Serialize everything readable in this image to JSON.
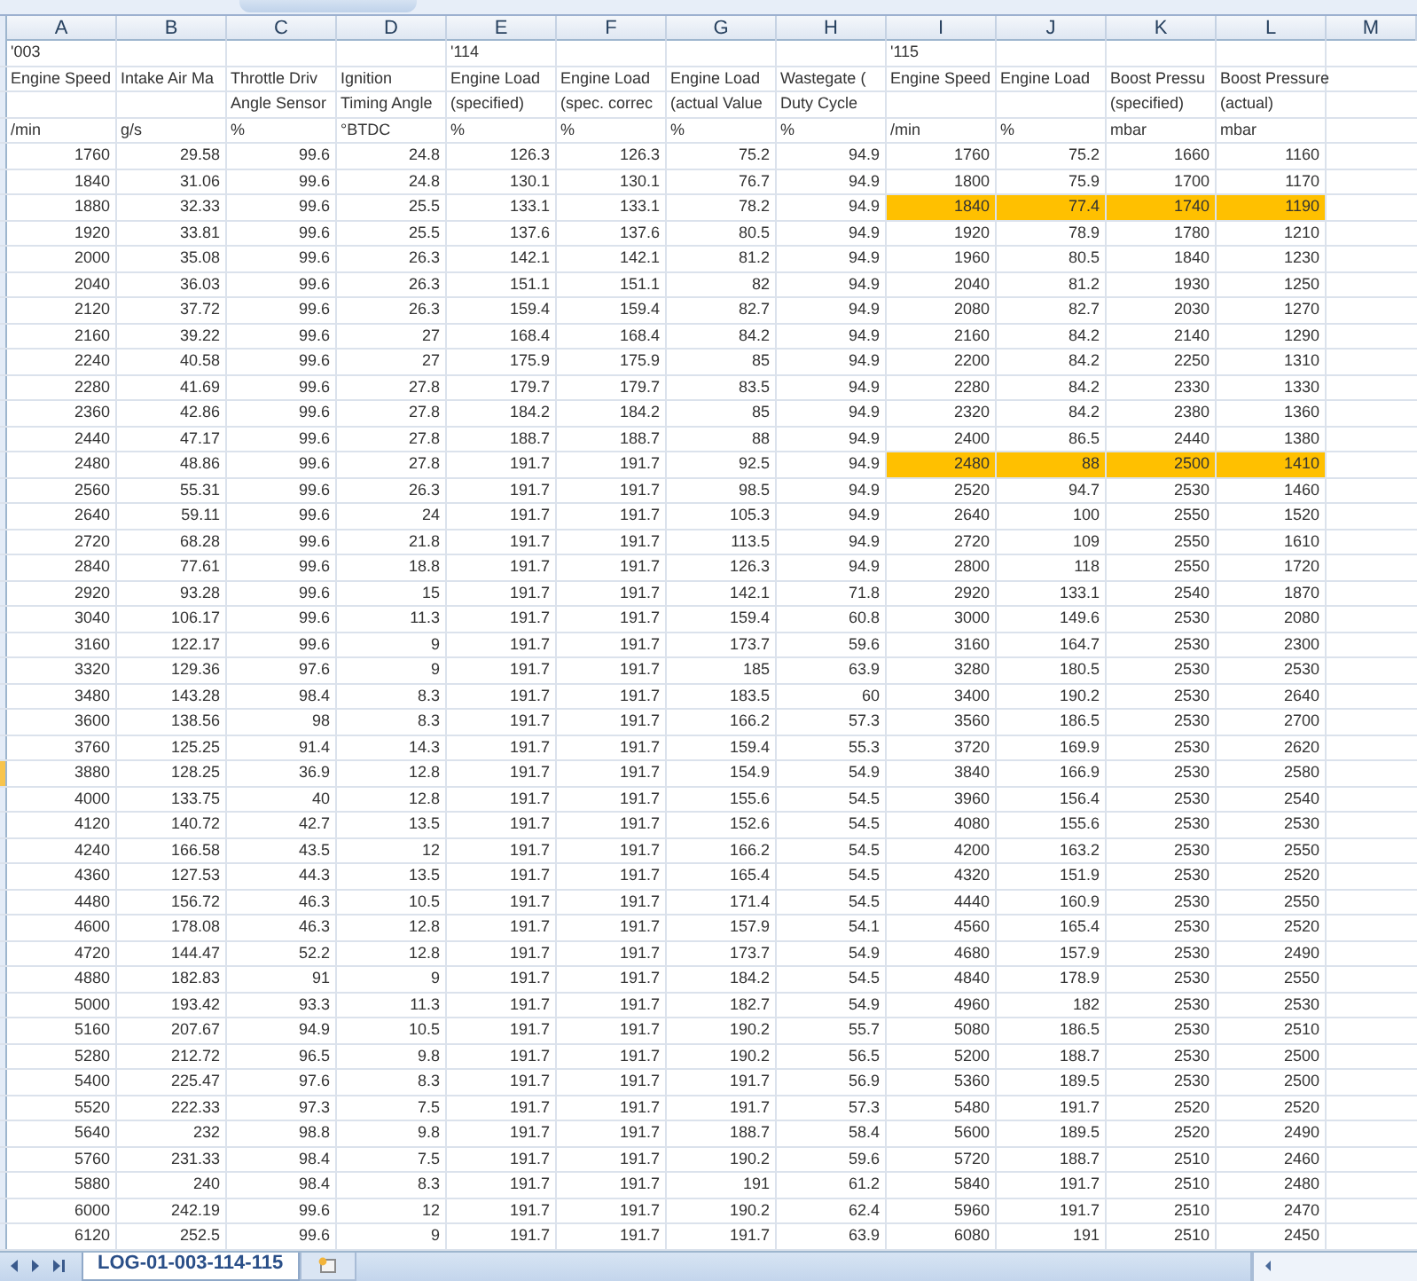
{
  "columns": [
    "A",
    "B",
    "C",
    "D",
    "E",
    "F",
    "G",
    "H",
    "I",
    "J",
    "K",
    "L",
    "M"
  ],
  "header_rows": [
    {
      "cells": {
        "A": "'003",
        "E": "'114",
        "I": "'115"
      }
    },
    {
      "cells": {
        "A": "Engine Speed",
        "B": "Intake Air Ma",
        "C": "Throttle Driv",
        "D": "Ignition",
        "E": "Engine Load",
        "F": "Engine Load",
        "G": "Engine Load",
        "H": "Wastegate (",
        "I": "Engine Speed",
        "J": "Engine Load",
        "K": "Boost Pressu",
        "L": "Boost Pressure"
      }
    },
    {
      "cells": {
        "C": "Angle Sensor",
        "D": "Timing Angle",
        "E": "(specified)",
        "F": "(spec. correc",
        "G": "(actual Value",
        "H": "Duty Cycle",
        "K": "(specified)",
        "L": "(actual)"
      }
    },
    {
      "cells": {
        "A": "/min",
        "B": "g/s",
        "C": "%",
        "D": "°BTDC",
        "E": "%",
        "F": "%",
        "G": "%",
        "H": "%",
        "I": "/min",
        "J": "%",
        "K": "mbar",
        "L": "mbar"
      }
    }
  ],
  "data_rows": [
    {
      "cells": [
        "1760",
        "29.58",
        "99.6",
        "24.8",
        "126.3",
        "126.3",
        "75.2",
        "94.9",
        "1760",
        "75.2",
        "1660",
        "1160"
      ],
      "active": false
    },
    {
      "cells": [
        "1840",
        "31.06",
        "99.6",
        "24.8",
        "130.1",
        "130.1",
        "76.7",
        "94.9",
        "1800",
        "75.9",
        "1700",
        "1170"
      ],
      "active": false
    },
    {
      "cells": [
        "1880",
        "32.33",
        "99.6",
        "25.5",
        "133.1",
        "133.1",
        "78.2",
        "94.9",
        "1840",
        "77.4",
        "1740",
        "1190"
      ],
      "active": false,
      "highlighted_cells": [
        false,
        false,
        false,
        false,
        false,
        false,
        false,
        false,
        true,
        true,
        true,
        true
      ]
    },
    {
      "cells": [
        "1920",
        "33.81",
        "99.6",
        "25.5",
        "137.6",
        "137.6",
        "80.5",
        "94.9",
        "1920",
        "78.9",
        "1780",
        "1210"
      ],
      "active": false
    },
    {
      "cells": [
        "2000",
        "35.08",
        "99.6",
        "26.3",
        "142.1",
        "142.1",
        "81.2",
        "94.9",
        "1960",
        "80.5",
        "1840",
        "1230"
      ],
      "active": false
    },
    {
      "cells": [
        "2040",
        "36.03",
        "99.6",
        "26.3",
        "151.1",
        "151.1",
        "82",
        "94.9",
        "2040",
        "81.2",
        "1930",
        "1250"
      ],
      "active": false
    },
    {
      "cells": [
        "2120",
        "37.72",
        "99.6",
        "26.3",
        "159.4",
        "159.4",
        "82.7",
        "94.9",
        "2080",
        "82.7",
        "2030",
        "1270"
      ],
      "active": false
    },
    {
      "cells": [
        "2160",
        "39.22",
        "99.6",
        "27",
        "168.4",
        "168.4",
        "84.2",
        "94.9",
        "2160",
        "84.2",
        "2140",
        "1290"
      ],
      "active": false
    },
    {
      "cells": [
        "2240",
        "40.58",
        "99.6",
        "27",
        "175.9",
        "175.9",
        "85",
        "94.9",
        "2200",
        "84.2",
        "2250",
        "1310"
      ],
      "active": false
    },
    {
      "cells": [
        "2280",
        "41.69",
        "99.6",
        "27.8",
        "179.7",
        "179.7",
        "83.5",
        "94.9",
        "2280",
        "84.2",
        "2330",
        "1330"
      ],
      "active": false
    },
    {
      "cells": [
        "2360",
        "42.86",
        "99.6",
        "27.8",
        "184.2",
        "184.2",
        "85",
        "94.9",
        "2320",
        "84.2",
        "2380",
        "1360"
      ],
      "active": false
    },
    {
      "cells": [
        "2440",
        "47.17",
        "99.6",
        "27.8",
        "188.7",
        "188.7",
        "88",
        "94.9",
        "2400",
        "86.5",
        "2440",
        "1380"
      ],
      "active": false
    },
    {
      "cells": [
        "2480",
        "48.86",
        "99.6",
        "27.8",
        "191.7",
        "191.7",
        "92.5",
        "94.9",
        "2480",
        "88",
        "2500",
        "1410"
      ],
      "active": false,
      "highlighted_cells": [
        false,
        false,
        false,
        false,
        false,
        false,
        false,
        false,
        true,
        true,
        true,
        true
      ]
    },
    {
      "cells": [
        "2560",
        "55.31",
        "99.6",
        "26.3",
        "191.7",
        "191.7",
        "98.5",
        "94.9",
        "2520",
        "94.7",
        "2530",
        "1460"
      ],
      "active": false
    },
    {
      "cells": [
        "2640",
        "59.11",
        "99.6",
        "24",
        "191.7",
        "191.7",
        "105.3",
        "94.9",
        "2640",
        "100",
        "2550",
        "1520"
      ],
      "active": false
    },
    {
      "cells": [
        "2720",
        "68.28",
        "99.6",
        "21.8",
        "191.7",
        "191.7",
        "113.5",
        "94.9",
        "2720",
        "109",
        "2550",
        "1610"
      ],
      "active": false
    },
    {
      "cells": [
        "2840",
        "77.61",
        "99.6",
        "18.8",
        "191.7",
        "191.7",
        "126.3",
        "94.9",
        "2800",
        "118",
        "2550",
        "1720"
      ],
      "active": false
    },
    {
      "cells": [
        "2920",
        "93.28",
        "99.6",
        "15",
        "191.7",
        "191.7",
        "142.1",
        "71.8",
        "2920",
        "133.1",
        "2540",
        "1870"
      ],
      "active": false
    },
    {
      "cells": [
        "3040",
        "106.17",
        "99.6",
        "11.3",
        "191.7",
        "191.7",
        "159.4",
        "60.8",
        "3000",
        "149.6",
        "2530",
        "2080"
      ],
      "active": false
    },
    {
      "cells": [
        "3160",
        "122.17",
        "99.6",
        "9",
        "191.7",
        "191.7",
        "173.7",
        "59.6",
        "3160",
        "164.7",
        "2530",
        "2300"
      ],
      "active": false
    },
    {
      "cells": [
        "3320",
        "129.36",
        "97.6",
        "9",
        "191.7",
        "191.7",
        "185",
        "63.9",
        "3280",
        "180.5",
        "2530",
        "2530"
      ],
      "active": false
    },
    {
      "cells": [
        "3480",
        "143.28",
        "98.4",
        "8.3",
        "191.7",
        "191.7",
        "183.5",
        "60",
        "3400",
        "190.2",
        "2530",
        "2640"
      ],
      "active": false
    },
    {
      "cells": [
        "3600",
        "138.56",
        "98",
        "8.3",
        "191.7",
        "191.7",
        "166.2",
        "57.3",
        "3560",
        "186.5",
        "2530",
        "2700"
      ],
      "active": false
    },
    {
      "cells": [
        "3760",
        "125.25",
        "91.4",
        "14.3",
        "191.7",
        "191.7",
        "159.4",
        "55.3",
        "3720",
        "169.9",
        "2530",
        "2620"
      ],
      "active": false
    },
    {
      "cells": [
        "3880",
        "128.25",
        "36.9",
        "12.8",
        "191.7",
        "191.7",
        "154.9",
        "54.9",
        "3840",
        "166.9",
        "2530",
        "2580"
      ],
      "active": true
    },
    {
      "cells": [
        "4000",
        "133.75",
        "40",
        "12.8",
        "191.7",
        "191.7",
        "155.6",
        "54.5",
        "3960",
        "156.4",
        "2530",
        "2540"
      ],
      "active": false
    },
    {
      "cells": [
        "4120",
        "140.72",
        "42.7",
        "13.5",
        "191.7",
        "191.7",
        "152.6",
        "54.5",
        "4080",
        "155.6",
        "2530",
        "2530"
      ],
      "active": false
    },
    {
      "cells": [
        "4240",
        "166.58",
        "43.5",
        "12",
        "191.7",
        "191.7",
        "166.2",
        "54.5",
        "4200",
        "163.2",
        "2530",
        "2550"
      ],
      "active": false
    },
    {
      "cells": [
        "4360",
        "127.53",
        "44.3",
        "13.5",
        "191.7",
        "191.7",
        "165.4",
        "54.5",
        "4320",
        "151.9",
        "2530",
        "2520"
      ],
      "active": false
    },
    {
      "cells": [
        "4480",
        "156.72",
        "46.3",
        "10.5",
        "191.7",
        "191.7",
        "171.4",
        "54.5",
        "4440",
        "160.9",
        "2530",
        "2550"
      ],
      "active": false
    },
    {
      "cells": [
        "4600",
        "178.08",
        "46.3",
        "12.8",
        "191.7",
        "191.7",
        "157.9",
        "54.1",
        "4560",
        "165.4",
        "2530",
        "2520"
      ],
      "active": false
    },
    {
      "cells": [
        "4720",
        "144.47",
        "52.2",
        "12.8",
        "191.7",
        "191.7",
        "173.7",
        "54.9",
        "4680",
        "157.9",
        "2530",
        "2490"
      ],
      "active": false
    },
    {
      "cells": [
        "4880",
        "182.83",
        "91",
        "9",
        "191.7",
        "191.7",
        "184.2",
        "54.5",
        "4840",
        "178.9",
        "2530",
        "2550"
      ],
      "active": false
    },
    {
      "cells": [
        "5000",
        "193.42",
        "93.3",
        "11.3",
        "191.7",
        "191.7",
        "182.7",
        "54.9",
        "4960",
        "182",
        "2530",
        "2530"
      ],
      "active": false
    },
    {
      "cells": [
        "5160",
        "207.67",
        "94.9",
        "10.5",
        "191.7",
        "191.7",
        "190.2",
        "55.7",
        "5080",
        "186.5",
        "2530",
        "2510"
      ],
      "active": false
    },
    {
      "cells": [
        "5280",
        "212.72",
        "96.5",
        "9.8",
        "191.7",
        "191.7",
        "190.2",
        "56.5",
        "5200",
        "188.7",
        "2530",
        "2500"
      ],
      "active": false
    },
    {
      "cells": [
        "5400",
        "225.47",
        "97.6",
        "8.3",
        "191.7",
        "191.7",
        "191.7",
        "56.9",
        "5360",
        "189.5",
        "2530",
        "2500"
      ],
      "active": false
    },
    {
      "cells": [
        "5520",
        "222.33",
        "97.3",
        "7.5",
        "191.7",
        "191.7",
        "191.7",
        "57.3",
        "5480",
        "191.7",
        "2520",
        "2520"
      ],
      "active": false
    },
    {
      "cells": [
        "5640",
        "232",
        "98.8",
        "9.8",
        "191.7",
        "191.7",
        "188.7",
        "58.4",
        "5600",
        "189.5",
        "2520",
        "2490"
      ],
      "active": false
    },
    {
      "cells": [
        "5760",
        "231.33",
        "98.4",
        "7.5",
        "191.7",
        "191.7",
        "190.2",
        "59.6",
        "5720",
        "188.7",
        "2510",
        "2460"
      ],
      "active": false
    },
    {
      "cells": [
        "5880",
        "240",
        "98.4",
        "8.3",
        "191.7",
        "191.7",
        "191",
        "61.2",
        "5840",
        "191.7",
        "2510",
        "2480"
      ],
      "active": false
    },
    {
      "cells": [
        "6000",
        "242.19",
        "99.6",
        "12",
        "191.7",
        "191.7",
        "190.2",
        "62.4",
        "5960",
        "191.7",
        "2510",
        "2470"
      ],
      "active": false
    },
    {
      "cells": [
        "6120",
        "252.5",
        "99.6",
        "9",
        "191.7",
        "191.7",
        "191.7",
        "63.9",
        "6080",
        "191",
        "2510",
        "2450"
      ],
      "active": false
    }
  ],
  "sheet_tabs": [
    {
      "label": "LOG-01-003-114-115",
      "selected": true
    }
  ]
}
